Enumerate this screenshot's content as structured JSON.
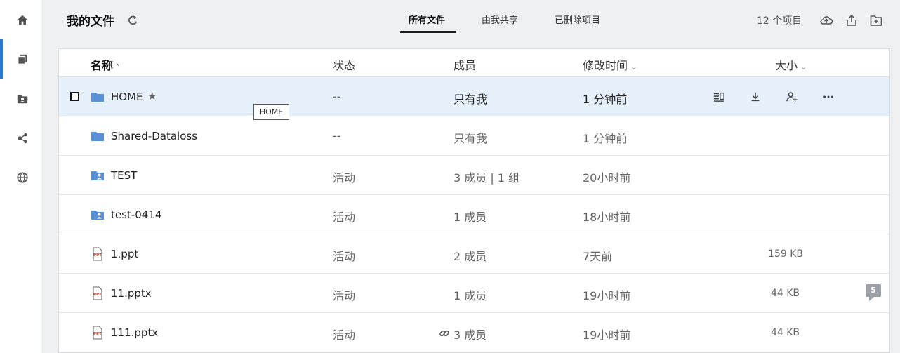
{
  "sidebar": {
    "items": [
      {
        "icon": "home-icon"
      },
      {
        "icon": "files-icon"
      },
      {
        "icon": "shared-folder-icon"
      },
      {
        "icon": "share-network-icon"
      },
      {
        "icon": "globe-icon"
      }
    ],
    "accent_color": "#2b7bd3"
  },
  "header": {
    "title": "我的文件",
    "tabs": [
      {
        "label": "所有文件",
        "active": true
      },
      {
        "label": "由我共享",
        "active": false
      },
      {
        "label": "已删除项目",
        "active": false
      }
    ],
    "item_count": "12 个项目"
  },
  "table": {
    "columns": {
      "name": "名称",
      "status": "状态",
      "members": "成员",
      "modified": "修改时间",
      "size": "大小"
    },
    "tooltip": "HOME",
    "rows": [
      {
        "name": "HOME",
        "type": "folder",
        "status": "--",
        "members": "只有我",
        "modified": "1 分钟前",
        "size": "",
        "selected": true,
        "starred": true
      },
      {
        "name": "Shared-Dataloss",
        "type": "folder",
        "status": "--",
        "members": "只有我",
        "modified": "1 分钟前",
        "size": ""
      },
      {
        "name": "TEST",
        "type": "shared-folder",
        "status": "活动",
        "members": "3 成员 | 1 组",
        "modified": "20小时前",
        "size": ""
      },
      {
        "name": "test-0414",
        "type": "shared-folder",
        "status": "活动",
        "members": "1 成员",
        "modified": "18小时前",
        "size": ""
      },
      {
        "name": "1.ppt",
        "type": "ppt",
        "status": "活动",
        "members": "2 成员",
        "modified": "7天前",
        "size": "159 KB"
      },
      {
        "name": "11.pptx",
        "type": "ppt",
        "status": "活动",
        "members": "1 成员",
        "modified": "19小时前",
        "size": "44 KB",
        "comments": "5"
      },
      {
        "name": "111.pptx",
        "type": "ppt",
        "status": "活动",
        "members": "3 成员",
        "modified": "19小时前",
        "size": "44 KB",
        "link": true
      }
    ]
  },
  "colors": {
    "folder": "#5b8fd3",
    "selected_row": "#e6f0fb",
    "ppt": "#c0392b"
  }
}
